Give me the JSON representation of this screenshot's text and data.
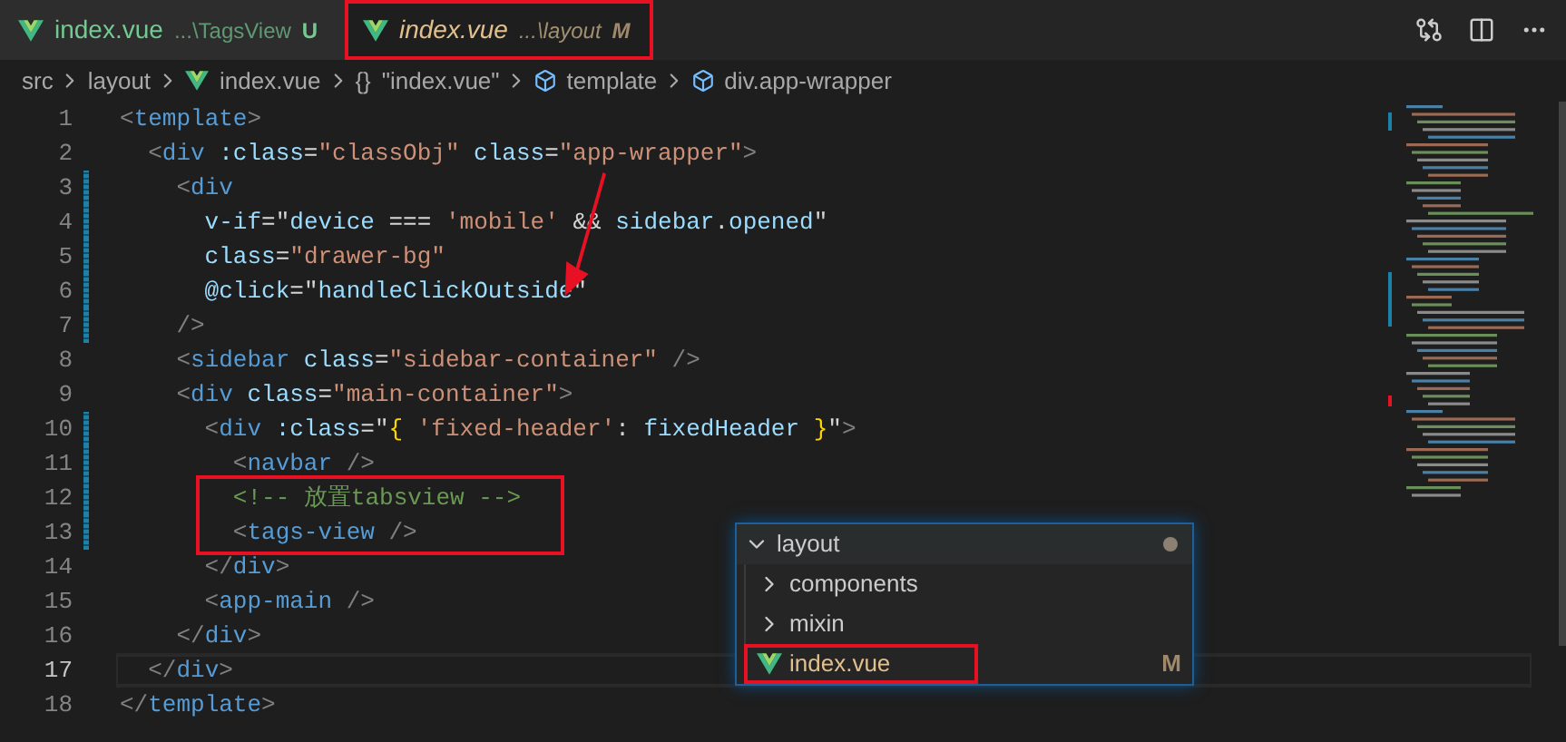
{
  "tabs": [
    {
      "name": "index.vue",
      "path": "...\\TagsView",
      "status": "U",
      "selected": false,
      "highlighted": false
    },
    {
      "name": "index.vue",
      "path": "...\\layout",
      "status": "M",
      "selected": true,
      "highlighted": true
    }
  ],
  "breadcrumb": [
    {
      "text": "src",
      "kind": "folder"
    },
    {
      "text": "layout",
      "kind": "folder"
    },
    {
      "text": "index.vue",
      "kind": "vue"
    },
    {
      "text": "\"index.vue\"",
      "kind": "object",
      "symbol": "{}"
    },
    {
      "text": "template",
      "kind": "element"
    },
    {
      "text": "div.app-wrapper",
      "kind": "element"
    }
  ],
  "code_lines": [
    {
      "number": "1",
      "modified": false,
      "current": false,
      "highlighted": false,
      "pointer": false,
      "tokens": [
        {
          "text": "<",
          "kind": "p"
        },
        {
          "text": "template",
          "kind": "tg"
        },
        {
          "text": ">",
          "kind": "p"
        }
      ]
    },
    {
      "number": "2",
      "modified": false,
      "current": false,
      "highlighted": false,
      "pointer": false,
      "tokens": [
        {
          "text": "  <",
          "kind": "p"
        },
        {
          "text": "div",
          "kind": "tg"
        },
        {
          "text": " :class",
          "kind": "at"
        },
        {
          "text": "=",
          "kind": "w"
        },
        {
          "text": "\"classObj\"",
          "kind": "s"
        },
        {
          "text": " class",
          "kind": "at"
        },
        {
          "text": "=",
          "kind": "w"
        },
        {
          "text": "\"app-wrapper\"",
          "kind": "s"
        },
        {
          "text": ">",
          "kind": "p"
        }
      ]
    },
    {
      "number": "3",
      "modified": true,
      "current": false,
      "highlighted": false,
      "pointer": false,
      "tokens": [
        {
          "text": "    <",
          "kind": "p"
        },
        {
          "text": "div",
          "kind": "tg"
        }
      ]
    },
    {
      "number": "4",
      "modified": true,
      "current": false,
      "highlighted": false,
      "pointer": false,
      "tokens": [
        {
          "text": "      v-if",
          "kind": "at"
        },
        {
          "text": "=",
          "kind": "w"
        },
        {
          "text": "\"",
          "kind": "w"
        },
        {
          "text": "device",
          "kind": "v"
        },
        {
          "text": " === ",
          "kind": "w"
        },
        {
          "text": "'mobile'",
          "kind": "s"
        },
        {
          "text": " && ",
          "kind": "w"
        },
        {
          "text": "sidebar",
          "kind": "v"
        },
        {
          "text": ".",
          "kind": "w"
        },
        {
          "text": "opened",
          "kind": "v"
        },
        {
          "text": "\"",
          "kind": "w"
        }
      ]
    },
    {
      "number": "5",
      "modified": true,
      "current": false,
      "highlighted": false,
      "pointer": false,
      "tokens": [
        {
          "text": "      class",
          "kind": "at"
        },
        {
          "text": "=",
          "kind": "w"
        },
        {
          "text": "\"drawer-bg\"",
          "kind": "s"
        }
      ]
    },
    {
      "number": "6",
      "modified": true,
      "current": false,
      "highlighted": false,
      "pointer": true,
      "tokens": [
        {
          "text": "      @click",
          "kind": "at"
        },
        {
          "text": "=",
          "kind": "w"
        },
        {
          "text": "\"",
          "kind": "w"
        },
        {
          "text": "handleClickOutside",
          "kind": "v"
        },
        {
          "text": "\"",
          "kind": "w"
        }
      ]
    },
    {
      "number": "7",
      "modified": true,
      "current": false,
      "highlighted": false,
      "pointer": false,
      "tokens": [
        {
          "text": "    />",
          "kind": "p"
        }
      ]
    },
    {
      "number": "8",
      "modified": false,
      "current": false,
      "highlighted": false,
      "pointer": false,
      "tokens": [
        {
          "text": "    <",
          "kind": "p"
        },
        {
          "text": "sidebar",
          "kind": "tg"
        },
        {
          "text": " class",
          "kind": "at"
        },
        {
          "text": "=",
          "kind": "w"
        },
        {
          "text": "\"sidebar-container\"",
          "kind": "s"
        },
        {
          "text": " />",
          "kind": "p"
        }
      ]
    },
    {
      "number": "9",
      "modified": false,
      "current": false,
      "highlighted": false,
      "pointer": false,
      "tokens": [
        {
          "text": "    <",
          "kind": "p"
        },
        {
          "text": "div",
          "kind": "tg"
        },
        {
          "text": " class",
          "kind": "at"
        },
        {
          "text": "=",
          "kind": "w"
        },
        {
          "text": "\"main-container\"",
          "kind": "s"
        },
        {
          "text": ">",
          "kind": "p"
        }
      ]
    },
    {
      "number": "10",
      "modified": true,
      "current": false,
      "highlighted": false,
      "pointer": false,
      "tokens": [
        {
          "text": "      <",
          "kind": "p"
        },
        {
          "text": "div",
          "kind": "tg"
        },
        {
          "text": " :class",
          "kind": "at"
        },
        {
          "text": "=",
          "kind": "w"
        },
        {
          "text": "\"",
          "kind": "w"
        },
        {
          "text": "{",
          "kind": "b"
        },
        {
          "text": " 'fixed-header'",
          "kind": "s"
        },
        {
          "text": ": ",
          "kind": "w"
        },
        {
          "text": "fixedHeader ",
          "kind": "v"
        },
        {
          "text": "}",
          "kind": "b"
        },
        {
          "text": "\"",
          "kind": "w"
        },
        {
          "text": ">",
          "kind": "p"
        }
      ]
    },
    {
      "number": "11",
      "modified": true,
      "current": false,
      "highlighted": false,
      "pointer": false,
      "tokens": [
        {
          "text": "        <",
          "kind": "p"
        },
        {
          "text": "navbar",
          "kind": "tg"
        },
        {
          "text": " />",
          "kind": "p"
        }
      ]
    },
    {
      "number": "12",
      "modified": true,
      "current": false,
      "highlighted": true,
      "pointer": false,
      "tokens": [
        {
          "text": "        <!-- 放置tabsview -->",
          "kind": "c"
        }
      ]
    },
    {
      "number": "13",
      "modified": true,
      "current": false,
      "highlighted": true,
      "pointer": false,
      "tokens": [
        {
          "text": "        <",
          "kind": "p"
        },
        {
          "text": "tags-view",
          "kind": "tg"
        },
        {
          "text": " />",
          "kind": "p"
        }
      ]
    },
    {
      "number": "14",
      "modified": false,
      "current": false,
      "highlighted": false,
      "pointer": false,
      "tokens": [
        {
          "text": "      </",
          "kind": "p"
        },
        {
          "text": "div",
          "kind": "tg"
        },
        {
          "text": ">",
          "kind": "p"
        }
      ]
    },
    {
      "number": "15",
      "modified": false,
      "current": false,
      "highlighted": false,
      "pointer": false,
      "tokens": [
        {
          "text": "      <",
          "kind": "p"
        },
        {
          "text": "app-main",
          "kind": "tg"
        },
        {
          "text": " />",
          "kind": "p"
        }
      ]
    },
    {
      "number": "16",
      "modified": false,
      "current": false,
      "highlighted": false,
      "pointer": false,
      "tokens": [
        {
          "text": "    </",
          "kind": "p"
        },
        {
          "text": "div",
          "kind": "tg"
        },
        {
          "text": ">",
          "kind": "p"
        }
      ]
    },
    {
      "number": "17",
      "modified": false,
      "current": true,
      "highlighted": false,
      "pointer": false,
      "tokens": [
        {
          "text": "  </",
          "kind": "p"
        },
        {
          "text": "div",
          "kind": "tg"
        },
        {
          "text": ">",
          "kind": "p"
        }
      ]
    },
    {
      "number": "18",
      "modified": false,
      "current": false,
      "highlighted": false,
      "pointer": false,
      "tokens": [
        {
          "text": "</",
          "kind": "p"
        },
        {
          "text": "template",
          "kind": "tg"
        },
        {
          "text": ">",
          "kind": "p"
        }
      ]
    }
  ],
  "tree_popup": {
    "label": "layout",
    "expanded": true,
    "modified": true,
    "children": [
      {
        "label": "components",
        "kind": "folder",
        "expanded": false,
        "highlighted": false
      },
      {
        "label": "mixin",
        "kind": "folder",
        "expanded": false,
        "highlighted": false
      },
      {
        "label": "index.vue",
        "kind": "vue",
        "status": "M",
        "highlighted": true
      }
    ]
  }
}
